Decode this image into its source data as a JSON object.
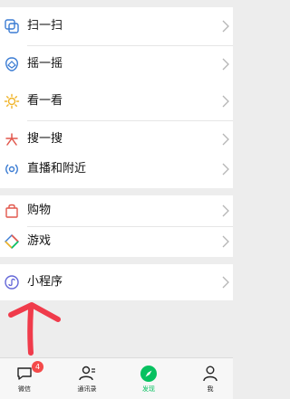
{
  "menu": {
    "scan": "扫一扫",
    "shake": "摇一摇",
    "top_stories": "看一看",
    "search": "搜一搜",
    "live_nearby": "直播和附近",
    "shopping": "购物",
    "games": "游戏",
    "mini_programs": "小程序"
  },
  "tabs": {
    "chats": "微信",
    "chats_badge": "4",
    "contacts": "通讯录",
    "discover": "发现",
    "me": "我"
  },
  "colors": {
    "accent": "#07c160",
    "badge": "#f44a4a",
    "arrow": "#f03b4b"
  }
}
